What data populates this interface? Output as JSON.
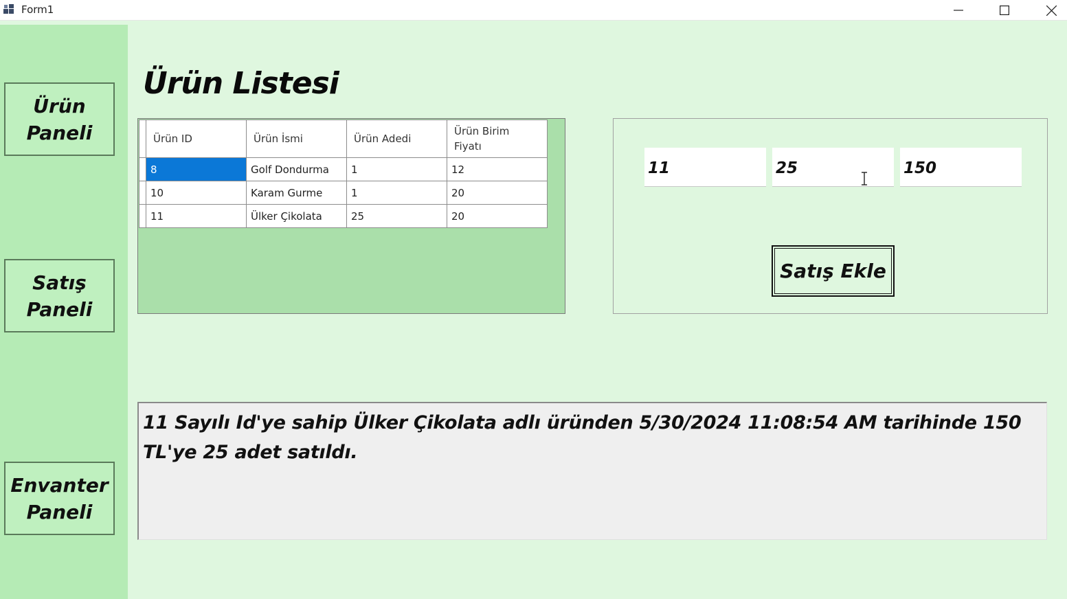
{
  "window": {
    "title": "Form1",
    "icons": {
      "app": "app-icon",
      "minimize": "minimize-icon",
      "maximize": "maximize-icon",
      "close": "close-icon"
    }
  },
  "sidebar": {
    "items": [
      {
        "label": "Ürün\nPaneli"
      },
      {
        "label": "Satış\nPaneli"
      },
      {
        "label": "Envanter\nPaneli"
      }
    ]
  },
  "main": {
    "title": "Ürün Listesi",
    "grid": {
      "columns": [
        "Ürün ID",
        "Ürün İsmi",
        "Ürün Adedi",
        "Ürün Birim\nFiyatı"
      ],
      "rows": [
        [
          "8",
          "Golf Dondurma",
          "1",
          "12"
        ],
        [
          "10",
          "Karam Gurme",
          "1",
          "20"
        ],
        [
          "11",
          "Ülker Çikolata",
          "25",
          "20"
        ]
      ],
      "selected_cell": "8"
    },
    "sale_form": {
      "product_id": "11",
      "quantity": "25",
      "price": "150",
      "add_button": "Satış Ekle"
    },
    "output": {
      "message": "11 Sayılı Id'ye sahip Ülker Çikolata adlı üründen 5/30/2024 11:08:54 AM tarihinde 150 TL'ye 25 adet satıldı."
    }
  },
  "colors": {
    "background": "#dff7df",
    "sidebar": "#b5ebb5",
    "grid_panel": "#aadfaa",
    "selection": "#0b78d7"
  }
}
